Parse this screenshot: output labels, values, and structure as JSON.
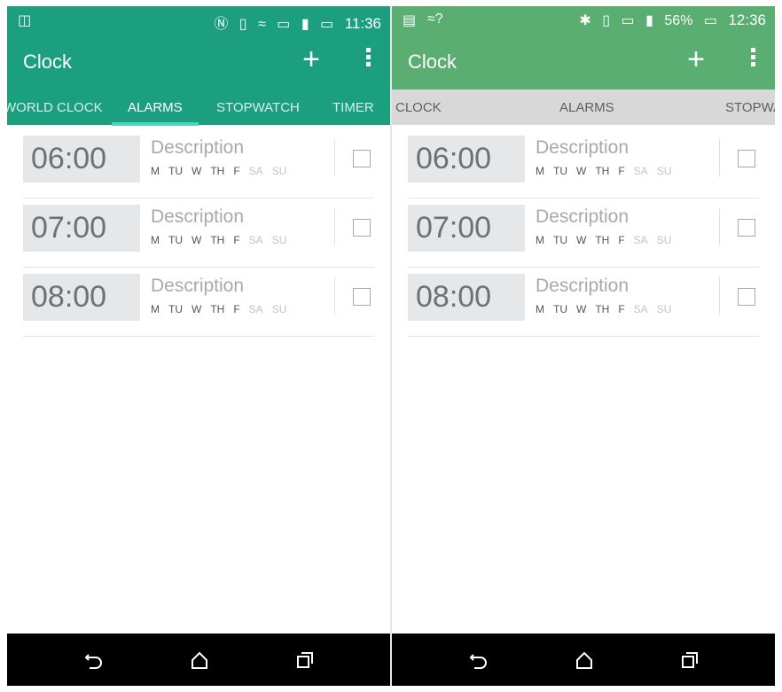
{
  "left": {
    "status": {
      "left_icons": [
        "sim-manager-icon"
      ],
      "right_icons": [
        "nfc-icon",
        "vibrate-icon",
        "wifi-icon",
        "storage-warning-icon",
        "signal-icon",
        "battery-charging-icon"
      ],
      "time": "11:36"
    },
    "appbar": {
      "title": "Clock",
      "add_label": "+",
      "colors": {
        "primary": "#1c9f7e",
        "indicator": "#4fd6bf"
      }
    },
    "tabs": [
      "WORLD CLOCK",
      "ALARMS",
      "STOPWATCH",
      "TIMER"
    ],
    "active_tab": "ALARMS",
    "alarms": [
      {
        "time": "06:00",
        "description": "Description",
        "checked": false
      },
      {
        "time": "07:00",
        "description": "Description",
        "checked": false
      },
      {
        "time": "08:00",
        "description": "Description",
        "checked": false
      }
    ],
    "days": [
      "M",
      "TU",
      "W",
      "TH",
      "F",
      "SA",
      "SU"
    ],
    "active_days": [
      "M",
      "TU",
      "W",
      "TH",
      "F"
    ],
    "navbar": [
      "back-icon",
      "home-icon",
      "recent-apps-icon"
    ]
  },
  "right": {
    "status": {
      "left_icons": [
        "screenshot-icon",
        "wifi-unknown-icon"
      ],
      "right_icons": [
        "bluetooth-icon",
        "vibrate-icon",
        "storage-warning-icon",
        "signal-icon"
      ],
      "battery_percent": "56%",
      "time": "12:36"
    },
    "appbar": {
      "title": "Clock",
      "add_label": "+",
      "colors": {
        "primary": "#5aae72",
        "tab_bg": "#d8d8d8"
      }
    },
    "tabs": [
      "WORLD CLOCK",
      "ALARMS",
      "STOPWATCH"
    ],
    "alarms": [
      {
        "time": "06:00",
        "description": "Description",
        "checked": false
      },
      {
        "time": "07:00",
        "description": "Description",
        "checked": false
      },
      {
        "time": "08:00",
        "description": "Description",
        "checked": false
      }
    ],
    "days": [
      "M",
      "TU",
      "W",
      "TH",
      "F",
      "SA",
      "SU"
    ],
    "active_days": [
      "M",
      "TU",
      "W",
      "TH",
      "F"
    ],
    "navbar": [
      "back-icon",
      "home-icon",
      "recent-apps-icon"
    ]
  }
}
